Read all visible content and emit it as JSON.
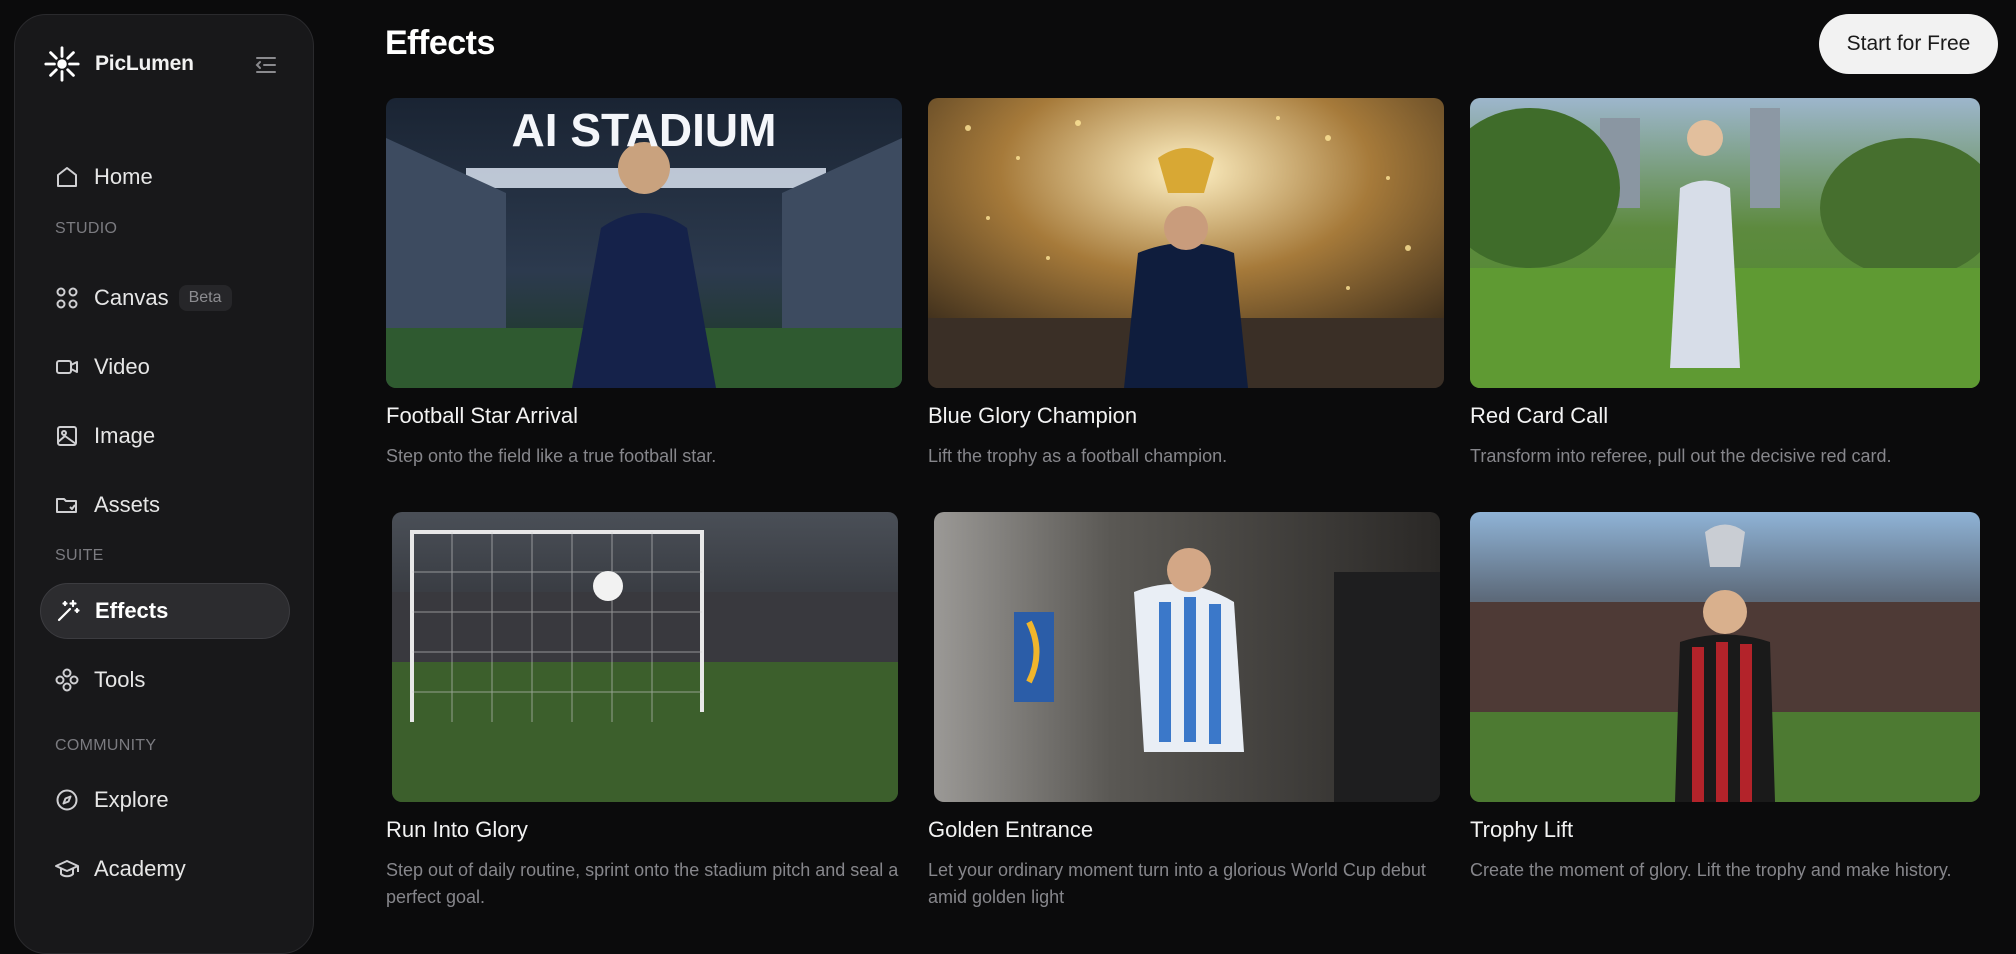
{
  "brand": {
    "name": "PicLumen"
  },
  "sidebar": {
    "home": "Home",
    "sections": {
      "studio": "STUDIO",
      "suite": "SUITE",
      "community": "COMMUNITY"
    },
    "items": {
      "canvas": "Canvas",
      "canvas_badge": "Beta",
      "video": "Video",
      "image": "Image",
      "assets": "Assets",
      "effects": "Effects",
      "tools": "Tools",
      "explore": "Explore",
      "academy": "Academy"
    },
    "active_item": "Effects"
  },
  "header": {
    "title": "Effects",
    "cta_label": "Start for Free"
  },
  "cards": [
    {
      "title": "Football Star Arrival",
      "description": "Step onto the field like a true football star.",
      "overlay_text": "AI STADIUM"
    },
    {
      "title": "Blue Glory Champion",
      "description": "Lift the trophy as a football champion."
    },
    {
      "title": "Red Card Call",
      "description": "Transform into referee, pull out the decisive red card."
    },
    {
      "title": "Run Into Glory",
      "description": "Step out of daily routine, sprint onto the stadium pitch and seal a perfect goal."
    },
    {
      "title": "Golden Entrance",
      "description": "Let your ordinary moment turn into a glorious World Cup debut amid golden light"
    },
    {
      "title": "Trophy Lift",
      "description": "Create the moment of glory. Lift the trophy and make history."
    }
  ],
  "colors": {
    "background": "#0b0b0c",
    "sidebar": "#18181a",
    "active_item": "#2c2c2f",
    "cta": "#f2f2f2"
  }
}
